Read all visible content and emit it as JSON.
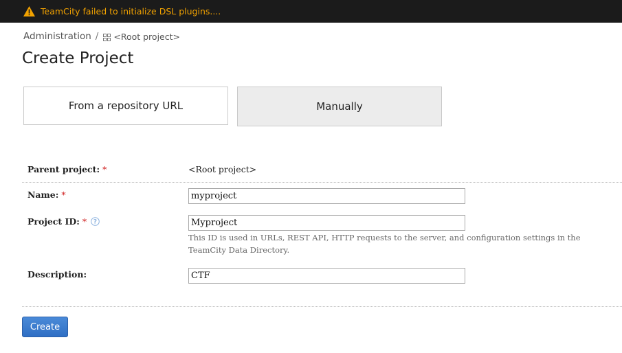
{
  "banner": {
    "message": "TeamCity failed to initialize DSL plugins....",
    "icon": "warning-icon",
    "color": "#f2a200"
  },
  "breadcrumb": {
    "item1": "Administration",
    "separator": "/",
    "item2": "<Root project>"
  },
  "page": {
    "title": "Create Project"
  },
  "tiles": {
    "repo_label": "From a repository URL",
    "manual_label": "Manually"
  },
  "form": {
    "parent_label": "Parent project:",
    "parent_value": "<Root project>",
    "name_label": "Name:",
    "name_value": "myproject",
    "id_label": "Project ID:",
    "id_value": "Myproject",
    "id_hint": "This ID is used in URLs, REST API, HTTP requests to the server, and configuration settings in the TeamCity Data Directory.",
    "desc_label": "Description:",
    "desc_value": "CTF",
    "required_mark": "*"
  },
  "actions": {
    "create_label": "Create",
    "accent": "#2f6fc4"
  }
}
